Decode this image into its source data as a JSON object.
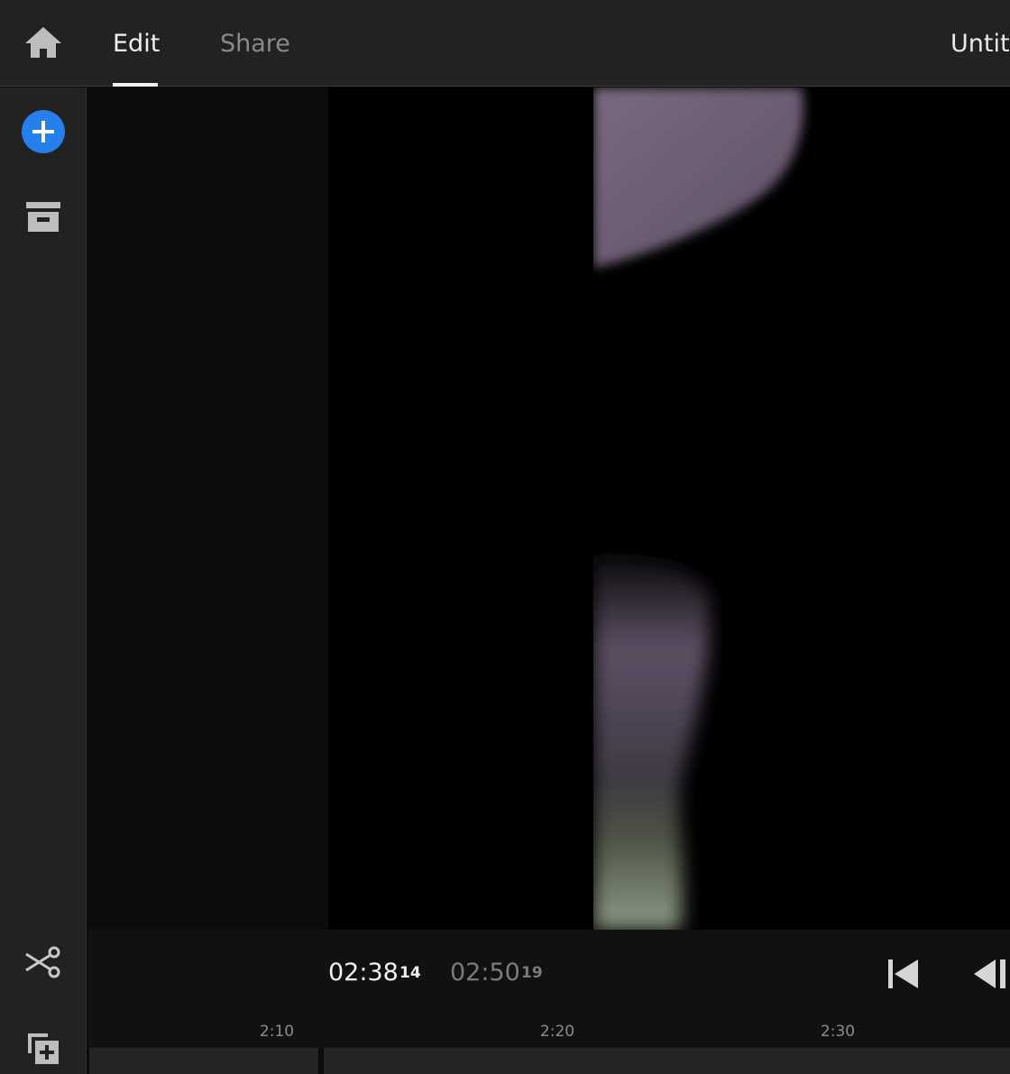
{
  "header": {
    "home_icon": "home-icon",
    "tabs": [
      {
        "label": "Edit",
        "active": true
      },
      {
        "label": "Share",
        "active": false
      }
    ],
    "project_title": "Untit"
  },
  "sidebar": {
    "items": [
      {
        "icon": "add-media-icon",
        "name": "add-media"
      },
      {
        "icon": "archive-icon",
        "name": "project-assets"
      },
      {
        "icon": "scissors-icon",
        "name": "split-clip"
      },
      {
        "icon": "add-layer-icon",
        "name": "add-layer"
      }
    ]
  },
  "player": {
    "current_time": "02:38",
    "current_frames": "14",
    "total_time": "02:50",
    "total_frames": "19",
    "controls": [
      "skip-to-start-icon",
      "step-back-icon"
    ]
  },
  "timeline": {
    "ticks": [
      "2:10",
      "2:20",
      "2:30"
    ]
  },
  "colors": {
    "accent": "#2680eb",
    "chrome": "#222222",
    "background": "#0b0b0b"
  }
}
